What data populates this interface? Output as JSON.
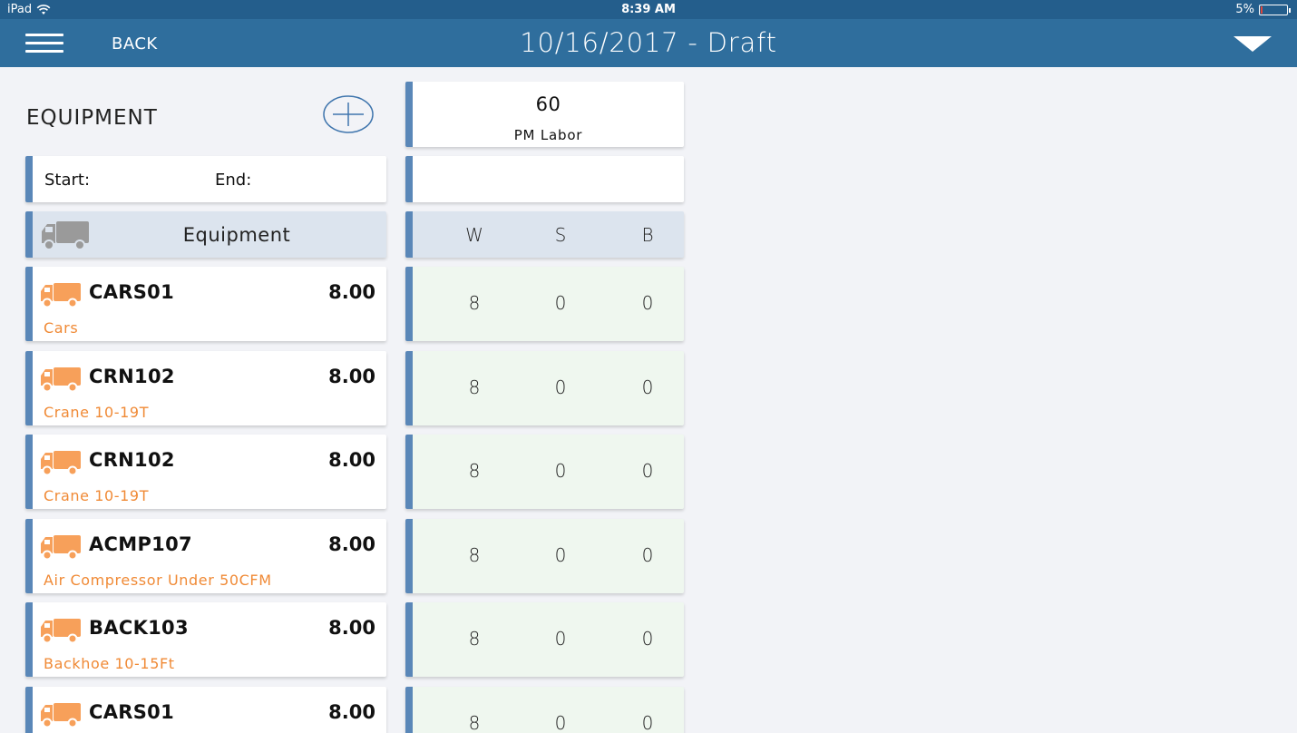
{
  "status_bar": {
    "device": "iPad",
    "time": "8:39 AM",
    "battery": "5%",
    "battery_level": 0.05
  },
  "nav": {
    "back_label": "BACK",
    "title": "10/16/2017 - Draft"
  },
  "equipment_section": {
    "title": "EQUIPMENT",
    "start_label": "Start:",
    "end_label": "End:",
    "column_header": "Equipment"
  },
  "summary": {
    "value": "60",
    "label": "PM Labor"
  },
  "wsb_headers": [
    "W",
    "S",
    "B"
  ],
  "equipment": [
    {
      "code": "CARS01",
      "hours": "8.00",
      "description": "Cars",
      "w": "8",
      "s": "0",
      "b": "0"
    },
    {
      "code": "CRN102",
      "hours": "8.00",
      "description": "Crane 10-19T",
      "w": "8",
      "s": "0",
      "b": "0"
    },
    {
      "code": "CRN102",
      "hours": "8.00",
      "description": "Crane 10-19T",
      "w": "8",
      "s": "0",
      "b": "0"
    },
    {
      "code": "ACMP107",
      "hours": "8.00",
      "description": "Air Compressor Under 50CFM",
      "w": "8",
      "s": "0",
      "b": "0"
    },
    {
      "code": "BACK103",
      "hours": "8.00",
      "description": "Backhoe 10-15Ft",
      "w": "8",
      "s": "0",
      "b": "0"
    },
    {
      "code": "CARS01",
      "hours": "8.00",
      "description": "",
      "w": "8",
      "s": "0",
      "b": "0"
    }
  ],
  "colors": {
    "nav_bar": "#2f6e9d",
    "card_accent": "#5a87b8",
    "truck_active": "#f7a05a",
    "truck_header": "#9a9a9a",
    "description_text": "#f08a36",
    "wsb_row_bg": "#eff7ef"
  }
}
